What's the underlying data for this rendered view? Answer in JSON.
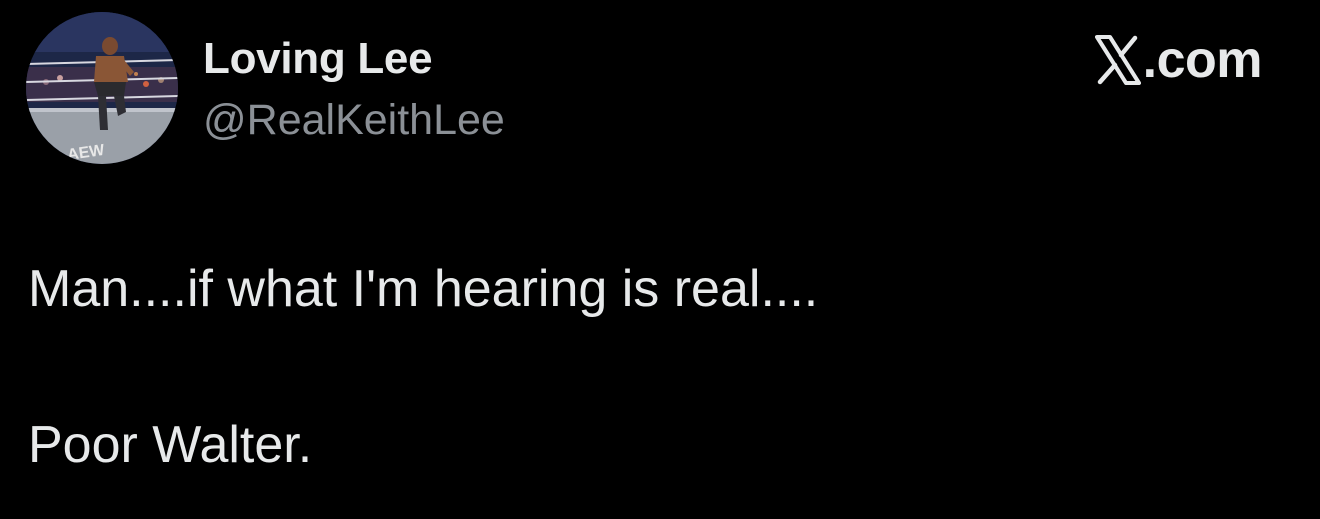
{
  "author": {
    "display_name": "Loving Lee",
    "handle": "@RealKeithLee",
    "avatar_logo": "AEW"
  },
  "brand": {
    "icon": "x-logo-icon",
    "text": ".com"
  },
  "tweet": {
    "lines": [
      "Man....if what I'm hearing is real....",
      "Poor Walter."
    ]
  },
  "colors": {
    "background": "#000000",
    "text_primary": "#e7e9ea",
    "text_secondary": "#8b9096"
  }
}
